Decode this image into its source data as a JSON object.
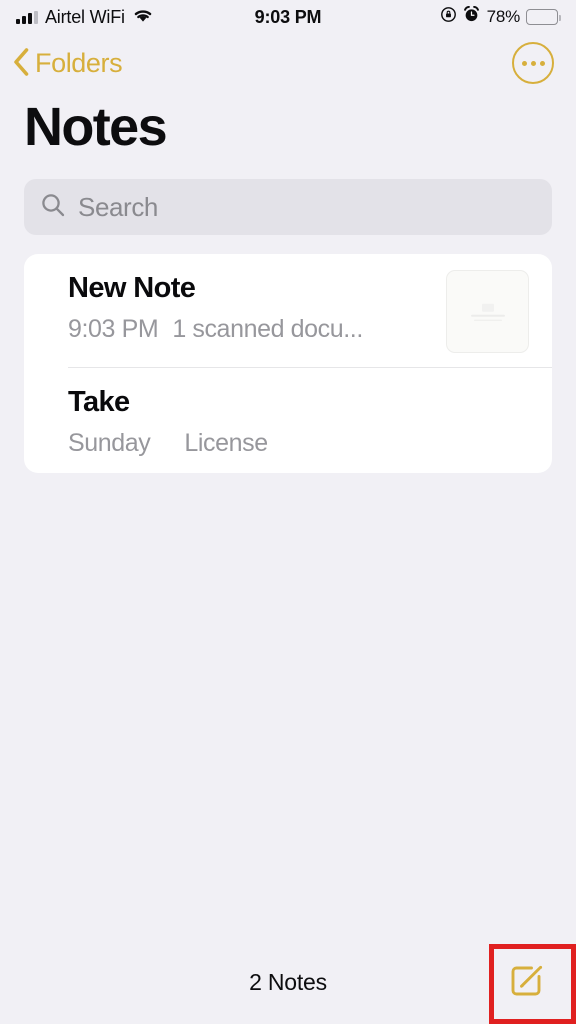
{
  "status_bar": {
    "carrier": "Airtel WiFi",
    "time": "9:03 PM",
    "battery_percent": "78%",
    "icons": [
      "signal-bars-icon",
      "wifi-icon",
      "rotation-lock-icon",
      "alarm-clock-icon",
      "battery-icon"
    ]
  },
  "nav": {
    "back_label": "Folders",
    "more_icon": "ellipsis-circle-icon"
  },
  "header": {
    "title": "Notes"
  },
  "search": {
    "placeholder": "Search",
    "value": "",
    "icon": "search-icon"
  },
  "notes": [
    {
      "title": "New Note",
      "date": "9:03 PM",
      "preview": "1 scanned docu...",
      "has_thumbnail": true,
      "thumbnail_icon": "scanned-document-thumbnail"
    },
    {
      "title": "Take",
      "date": "Sunday",
      "preview": "License",
      "has_thumbnail": false,
      "thumbnail_icon": ""
    }
  ],
  "bottom_bar": {
    "count_label": "2 Notes",
    "compose_icon": "compose-note-icon"
  },
  "colors": {
    "accent": "#D7AF3C",
    "page_background": "#F1F0F5",
    "card_background": "#FFFFFF",
    "search_background": "#E3E2E8",
    "secondary_text": "#97979C",
    "primary_text": "#0D0D0F",
    "highlight": "#E02020"
  }
}
